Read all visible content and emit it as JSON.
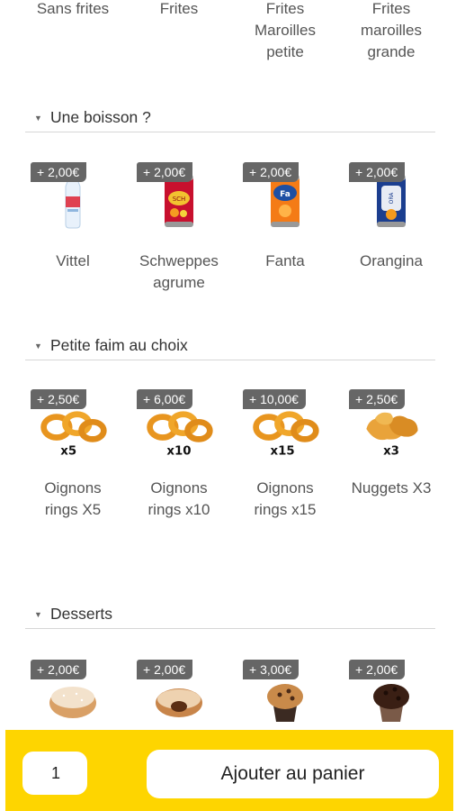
{
  "sides": {
    "items": [
      {
        "label": "Sans frites"
      },
      {
        "label": "Frites"
      },
      {
        "label": "Frites Maroilles petite"
      },
      {
        "label": "Frites maroilles grande"
      }
    ]
  },
  "drinks": {
    "title": "Une boisson ?",
    "items": [
      {
        "price": "+ 2,00€",
        "name": "Vittel",
        "icon": "water-bottle-icon"
      },
      {
        "price": "+ 2,00€",
        "name": "Schweppes agrume",
        "icon": "soda-can-icon"
      },
      {
        "price": "+ 2,00€",
        "name": "Fanta",
        "icon": "soda-can-icon"
      },
      {
        "price": "+ 2,00€",
        "name": "Orangina",
        "icon": "soda-can-icon"
      }
    ]
  },
  "snacks": {
    "title": "Petite faim au choix",
    "items": [
      {
        "price": "+ 2,50€",
        "name": "Oignons rings X5",
        "count": "x5"
      },
      {
        "price": "+ 6,00€",
        "name": "Oignons rings x10",
        "count": "x10"
      },
      {
        "price": "+ 10,00€",
        "name": "Oignons rings x15",
        "count": "x15"
      },
      {
        "price": "+ 2,50€",
        "name": "Nuggets X3",
        "count": "x3"
      }
    ]
  },
  "desserts": {
    "title": "Desserts",
    "items": [
      {
        "price": "+ 2,00€",
        "icon": "donut-icon"
      },
      {
        "price": "+ 2,00€",
        "icon": "filled-donut-icon"
      },
      {
        "price": "+ 3,00€",
        "icon": "muffin-icon"
      },
      {
        "price": "+ 2,00€",
        "icon": "chocolate-muffin-icon"
      }
    ]
  },
  "cart": {
    "quantity": "1",
    "add_label": "Ajouter au panier"
  },
  "colors": {
    "accent": "#fed500",
    "badge": "#666666"
  }
}
